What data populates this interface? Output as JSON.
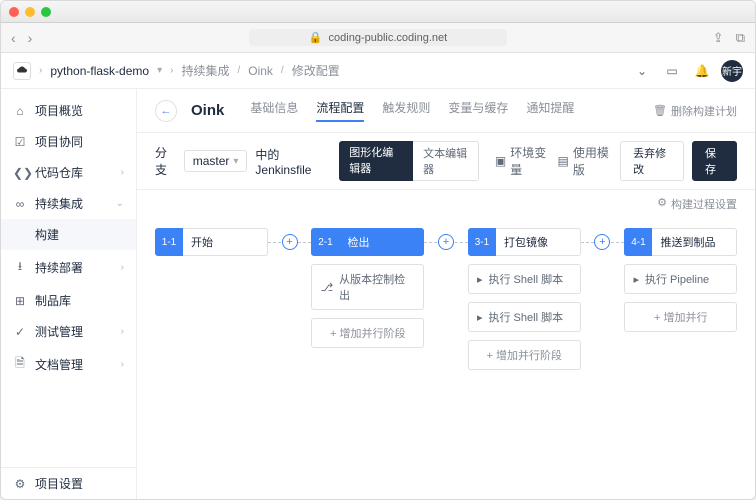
{
  "browser": {
    "url": "coding-public.coding.net"
  },
  "topbar": {
    "project": "python-flask-demo",
    "crumbs": [
      "持续集成",
      "Oink",
      "修改配置"
    ],
    "avatar": "新宇"
  },
  "sidebar": {
    "items": [
      {
        "icon": "home-icon",
        "label": "项目概览"
      },
      {
        "icon": "collab-icon",
        "label": "项目协同"
      },
      {
        "icon": "repo-icon",
        "label": "代码仓库",
        "arrow": "›"
      },
      {
        "icon": "ci-icon",
        "label": "持续集成",
        "arrow": "⌄"
      },
      {
        "icon": "",
        "label": "构建",
        "sub": true
      },
      {
        "icon": "deploy-icon",
        "label": "持续部署",
        "arrow": "›"
      },
      {
        "icon": "artifact-icon",
        "label": "制品库"
      },
      {
        "icon": "test-icon",
        "label": "测试管理",
        "arrow": "›"
      },
      {
        "icon": "doc-icon",
        "label": "文档管理",
        "arrow": "›"
      }
    ],
    "footer": {
      "label": "项目设置"
    }
  },
  "header": {
    "title": "Oink",
    "tabs": [
      "基础信息",
      "流程配置",
      "触发规则",
      "变量与缓存",
      "通知提醒"
    ],
    "activeTab": 1,
    "deletePlan": "删除构建计划"
  },
  "subbar": {
    "branchLabel": "分支",
    "branch": "master",
    "jenkinsfile": "中的 Jenkinsfile",
    "editorGraphic": "图形化编辑器",
    "editorText": "文本编辑器",
    "envVar": "环境变量",
    "useTemplate": "使用模版",
    "discard": "丢弃修改",
    "save": "保存"
  },
  "buildSettings": "构建过程设置",
  "stages": [
    {
      "num": "1-1",
      "name": "开始",
      "steps": []
    },
    {
      "num": "2-1",
      "name": "检出",
      "blue": true,
      "steps": [
        {
          "icon": "branch",
          "label": "从版本控制检出"
        }
      ],
      "add": "+ 增加并行阶段"
    },
    {
      "num": "3-1",
      "name": "打包镜像",
      "steps": [
        {
          "icon": "shell",
          "label": "执行 Shell 脚本"
        },
        {
          "icon": "shell",
          "label": "执行 Shell 脚本"
        }
      ],
      "add": "+ 增加并行阶段"
    },
    {
      "num": "4-1",
      "name": "推送到制品",
      "steps": [
        {
          "icon": "shell",
          "label": "执行 Pipeline"
        }
      ],
      "add": "+ 增加并行"
    }
  ]
}
